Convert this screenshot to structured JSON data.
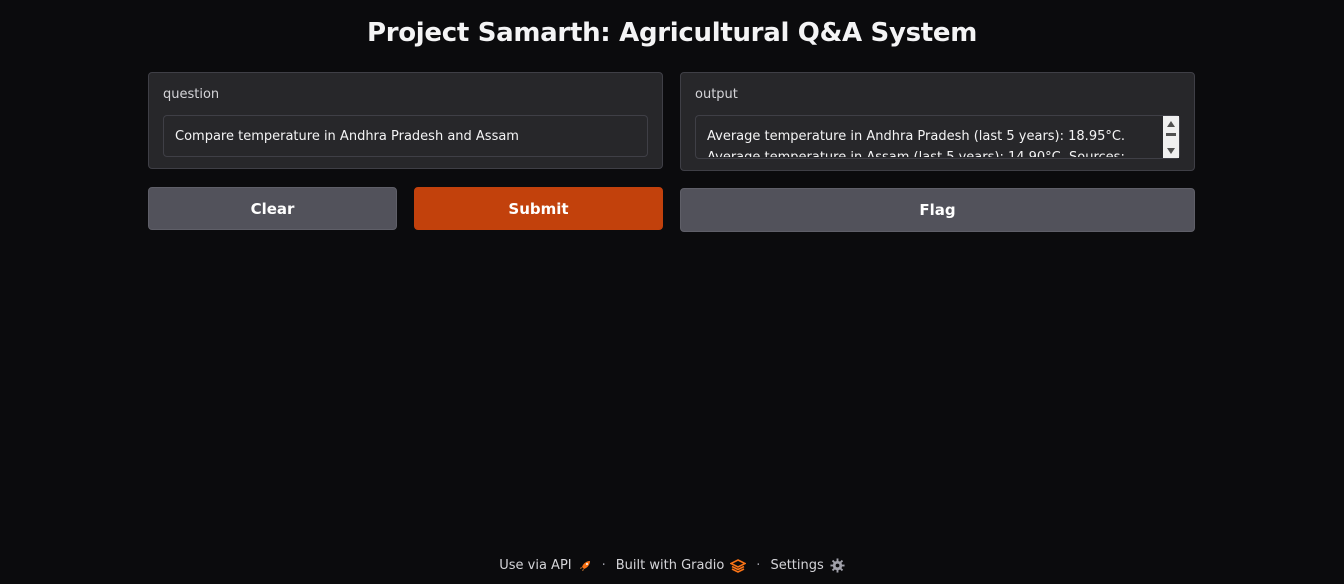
{
  "header": {
    "title": "Project Samarth: Agricultural Q&A System"
  },
  "question": {
    "label": "question",
    "value": "Compare temperature in Andhra Pradesh and Assam"
  },
  "output": {
    "label": "output",
    "value": "Average temperature in Andhra Pradesh (last 5 years): 18.95°C. Average temperature in Assam (last 5 years): 14.90°C. Sources: Climate data from"
  },
  "buttons": {
    "clear": "Clear",
    "submit": "Submit",
    "flag": "Flag"
  },
  "footer": {
    "api": "Use via API",
    "built": "Built with Gradio",
    "settings": "Settings",
    "separator": "·"
  },
  "colors": {
    "background": "#0b0b0d",
    "panel": "#27272a",
    "primary": "#c2410c",
    "secondary": "#52525b",
    "gradio_accent": "#f97316"
  },
  "icons": {
    "api": "rocket-icon",
    "gradio": "gradio-logo-icon",
    "settings": "gear-icon"
  }
}
